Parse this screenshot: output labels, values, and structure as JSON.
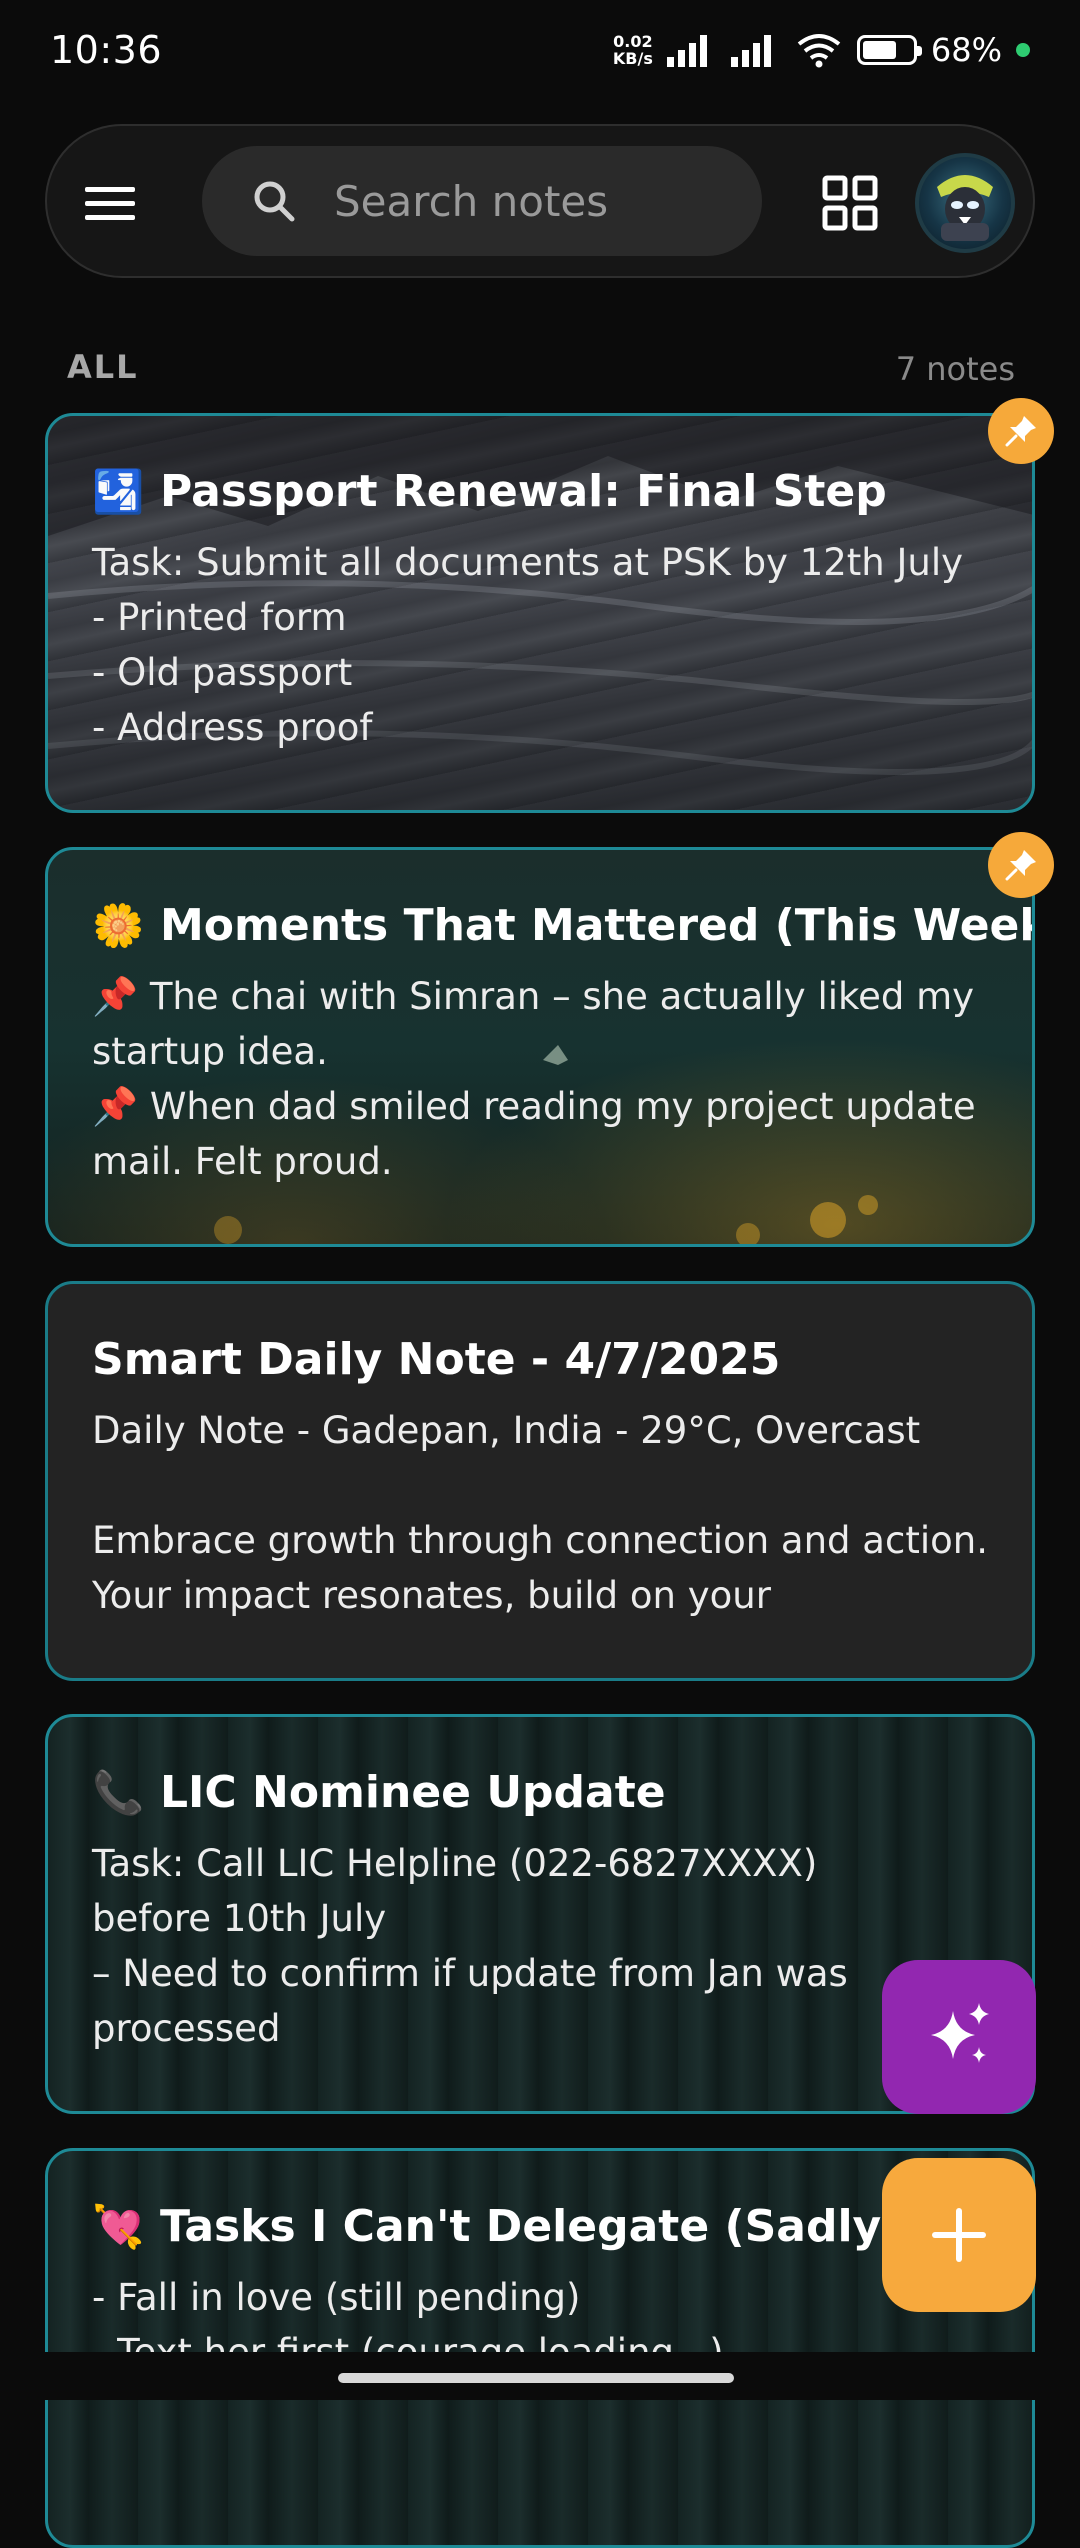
{
  "status_bar": {
    "time": "10:36",
    "net_speed_value": "0.02",
    "net_speed_unit": "KB/s",
    "battery_percent": "68%",
    "battery_level": 0.68,
    "battery_dot_color": "#2ecc71"
  },
  "top_bar": {
    "menu_icon": "hamburger-menu-icon",
    "search_placeholder": "Search notes",
    "search_icon": "search-icon",
    "grid_icon": "grid-view-icon",
    "avatar_icon": "profile-avatar"
  },
  "section": {
    "title": "ALL",
    "count": "7 notes"
  },
  "notes": [
    {
      "emoji": "🛂",
      "title": "Passport Renewal: Final Step",
      "body": "Task: Submit all documents at PSK by 12th July\n- Printed form\n- Old passport\n- Address proof",
      "pinned": true
    },
    {
      "emoji": "🌼",
      "title": "Moments That Mattered (This Week)",
      "body": "📌 The chai with Simran – she actually liked my startup idea.\n📌 When dad smiled reading my project update mail. Felt proud.",
      "pinned": true
    },
    {
      "emoji": "",
      "title": "Smart Daily Note - 4/7/2025",
      "body": "Daily Note - Gadepan, India - 29°C, Overcast\n\nEmbrace growth through connection and action. Your impact resonates, build on your strengths...",
      "pinned": false
    },
    {
      "emoji": "📞",
      "title": "LIC Nominee Update",
      "body": "Task: Call LIC Helpline (022-6827XXXX) before 10th July\n– Need to confirm if update from Jan was processed",
      "pinned": false
    },
    {
      "emoji": "💘",
      "title": "Tasks I Can't Delegate (Sadly)",
      "body": "- Fall in love (still pending)\n- Text her first (courage loading...)",
      "pinned": false
    }
  ],
  "fabs": {
    "ai_icon": "sparkles-icon",
    "ai_color": "#9227b0",
    "add_icon": "plus-icon",
    "add_color": "#f7a93d"
  },
  "colors": {
    "background": "#0b0b0b",
    "card_border": "#1e8a96",
    "pin_badge": "#f6a93a"
  }
}
